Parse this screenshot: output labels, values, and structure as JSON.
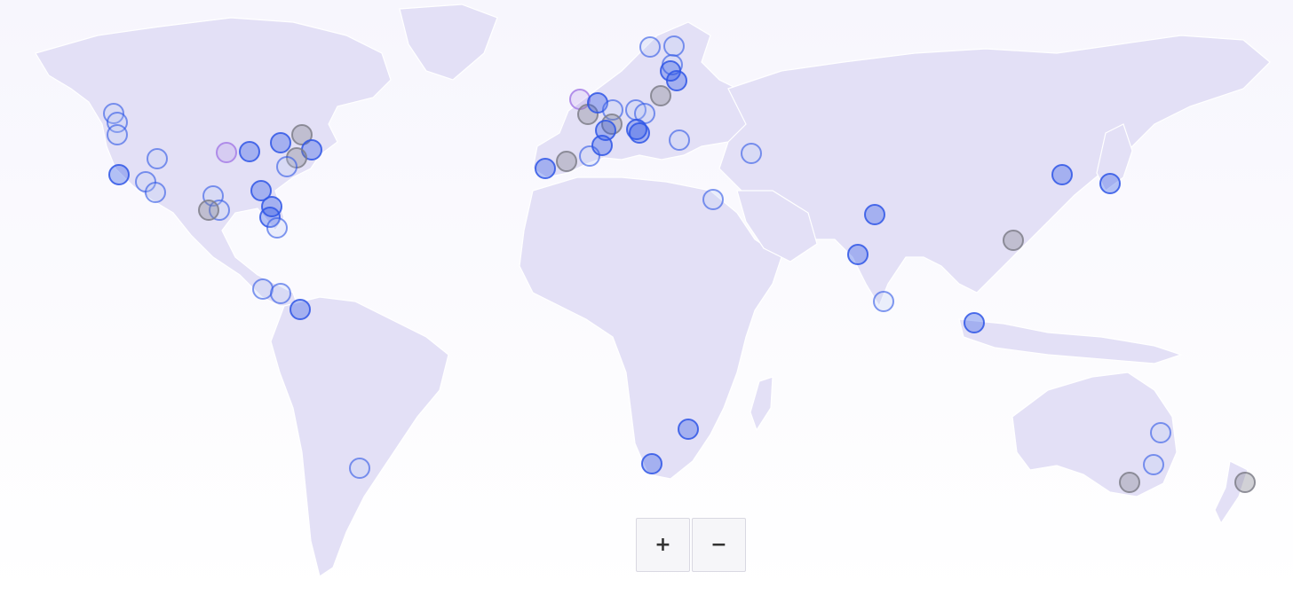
{
  "map": {
    "land_color": "#e3e0f6",
    "border_color": "#ffffff",
    "marker_colors": {
      "blue": "#2f56e6",
      "grey": "#7f7f8a",
      "purple": "#a77ee6",
      "light": "#b9c8f5"
    }
  },
  "zoom": {
    "in_label": "+",
    "out_label": "−"
  }
}
